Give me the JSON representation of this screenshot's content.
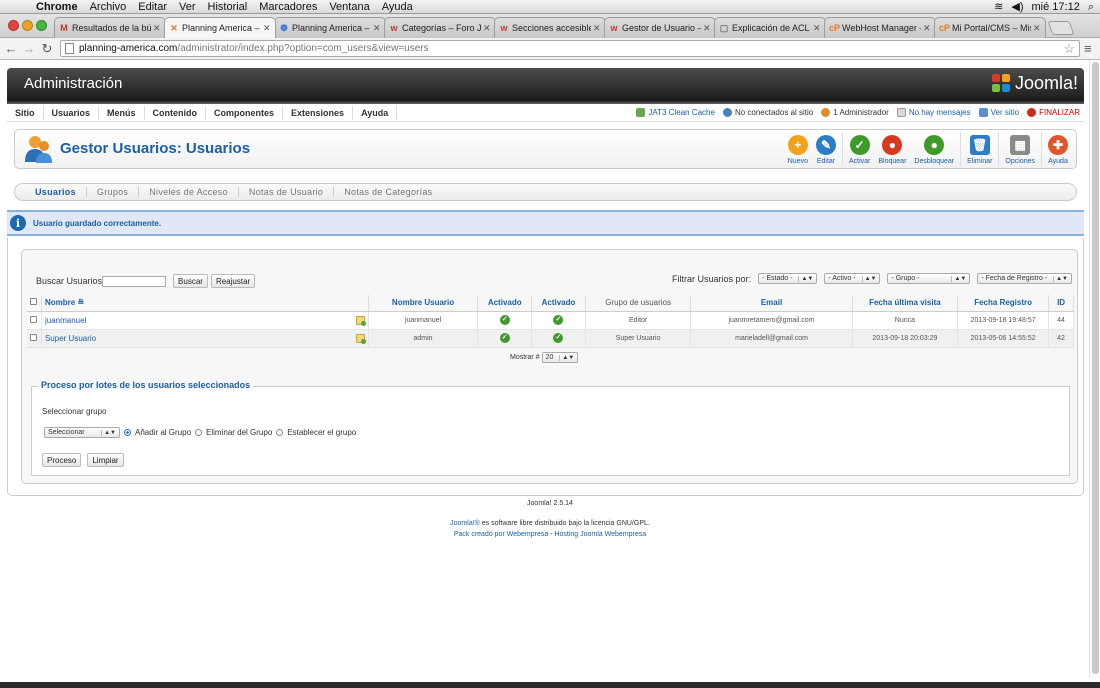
{
  "mac_menu": {
    "app": "Chrome",
    "items": [
      "Archivo",
      "Editar",
      "Ver",
      "Historial",
      "Marcadores",
      "Ventana",
      "Ayuda"
    ],
    "clock": "mié 17:12"
  },
  "browser": {
    "tabs": [
      {
        "title": "Resultados de la búsq",
        "favicon": "M",
        "color": "#c0392b"
      },
      {
        "title": "Planning America – Ad",
        "favicon": "✕",
        "color": "#e87a1e",
        "active": true
      },
      {
        "title": "Planning America – He",
        "favicon": "❁",
        "color": "#3a7bd5"
      },
      {
        "title": "Categorías – Foro Joom",
        "favicon": "w",
        "color": "#c0392b"
      },
      {
        "title": "Secciones accesibles s",
        "favicon": "w",
        "color": "#c0392b"
      },
      {
        "title": "Gestor de Usuario – He",
        "favicon": "w",
        "color": "#c0392b"
      },
      {
        "title": "Explicación de ACL en",
        "favicon": "▢",
        "color": "#777777"
      },
      {
        "title": "WebHost Manager – cP",
        "favicon": "cP",
        "color": "#e87a1e"
      },
      {
        "title": "Mi Portal/CMS – Mis A",
        "favicon": "cP",
        "color": "#e87a1e"
      }
    ],
    "url_host": "planning-america.com",
    "url_path": "/administrator/index.php?option=com_users&view=users"
  },
  "admin": {
    "header_title": "Administración",
    "logo_text": "Joomla!",
    "menu": [
      "Sitio",
      "Usuarios",
      "Menús",
      "Contenido",
      "Componentes",
      "Extensiones",
      "Ayuda"
    ],
    "status": {
      "cache": "JAT3 Clean Cache",
      "visitors": "No conectados al sitio",
      "admins": "1 Administrador",
      "messages": "No hay mensajes",
      "view_site": "Ver sitio",
      "logout": "FINALIZAR"
    }
  },
  "page": {
    "title": "Gestor Usuarios: Usuarios",
    "toolbar": [
      {
        "label": "Nuevo",
        "icon": "plus-icon",
        "color": "#f2a21b",
        "glyph": "+"
      },
      {
        "label": "Editar",
        "icon": "pencil-icon",
        "color": "#2d7cc8",
        "glyph": "✎"
      },
      {
        "label": "Activar",
        "icon": "check-icon",
        "color": "#3f9a2a",
        "glyph": "✓"
      },
      {
        "label": "Bloquear",
        "icon": "block-icon",
        "color": "#d63a1e",
        "glyph": "●"
      },
      {
        "label": "Desbloquear",
        "icon": "unblock-icon",
        "color": "#3f9a2a",
        "glyph": "●"
      },
      {
        "label": "Eliminar",
        "icon": "trash-icon",
        "color": "#2d7cc8",
        "glyph": "🗑"
      },
      {
        "label": "Opciones",
        "icon": "options-icon",
        "color": "#8a8a8a",
        "glyph": "▦"
      },
      {
        "label": "Ayuda",
        "icon": "lifebuoy-icon",
        "color": "#e0552a",
        "glyph": "✚"
      }
    ],
    "subnav": [
      "Usuarios",
      "Grupos",
      "Niveles de Acceso",
      "Notas de Usuario",
      "Notas de Categorías"
    ],
    "message": "Usuario guardado correctamente."
  },
  "filters": {
    "search_label": "Buscar Usuarios",
    "search_value": "",
    "search_button": "Buscar",
    "reset_button": "Reajustar",
    "filter_label": "Filtrar Usuarios por:",
    "selects": [
      "- Estado -",
      "- Activo -",
      "- Grupo -",
      "- Fecha de Registro -"
    ]
  },
  "table": {
    "headers": [
      "Nombre",
      "Nombre Usuario",
      "Activado",
      "Activado",
      "Grupo de usuarios",
      "Email",
      "Fecha última visita",
      "Fecha Registro",
      "ID"
    ],
    "rows": [
      {
        "name": "juanmanuel",
        "username": "juanmanuel",
        "group": "Editor",
        "email": "juanmretamero@gmail.com",
        "last_visit": "Nunca",
        "registered": "2013-09-18 19:48:57",
        "id": "44"
      },
      {
        "name": "Super Usuario",
        "username": "admin",
        "group": "Super Usuario",
        "email": "marieladell@gmail.com",
        "last_visit": "2013-09-18 20:03:29",
        "registered": "2013-05-06 14:55:52",
        "id": "42"
      }
    ],
    "show_label": "Mostrar #",
    "show_value": "20"
  },
  "batch": {
    "legend": "Proceso por lotes de los usuarios seleccionados",
    "group_label": "Seleccionar grupo",
    "group_select": "Seleccionar",
    "options": [
      "Añadir al Grupo",
      "Eliminar del Grupo",
      "Establecer el grupo"
    ],
    "process_button": "Proceso",
    "clear_button": "Limpiar"
  },
  "footer": {
    "version": "Joomla! 2.5.14",
    "license_link": "Joomla!®",
    "license_text": " es software libre distribuido bajo la licencia GNU/GPL.",
    "credit_link1": "Pack creado por Webempresa",
    "credit_sep": " - ",
    "credit_link2": "Hosting Joomla Webempresa"
  }
}
